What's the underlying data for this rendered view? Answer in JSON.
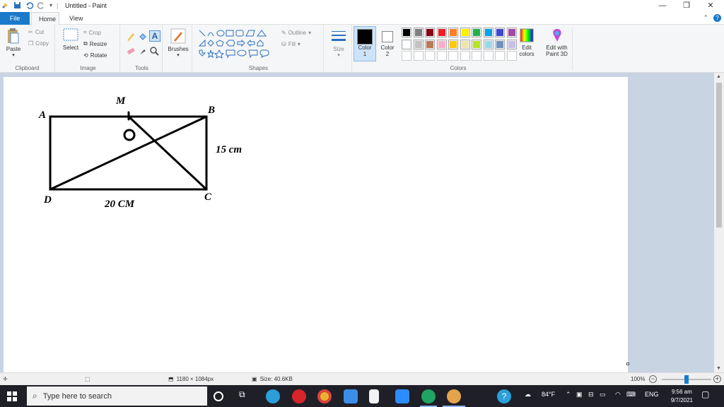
{
  "window": {
    "title": "Untitled - Paint",
    "minimize": "—",
    "maximize": "❐",
    "close": "✕"
  },
  "tabs": {
    "file": "File",
    "home": "Home",
    "view": "View"
  },
  "ribbon": {
    "clipboard": {
      "label": "Clipboard",
      "paste": "Paste",
      "cut": "Cut",
      "copy": "Copy"
    },
    "image": {
      "label": "Image",
      "select": "Select",
      "crop": "Crop",
      "resize": "Resize",
      "rotate": "Rotate"
    },
    "tools": {
      "label": "Tools"
    },
    "brushes": {
      "label": "Brushes"
    },
    "shapes": {
      "label": "Shapes",
      "outline": "Outline",
      "fill": "Fill"
    },
    "size": {
      "label": "Size"
    },
    "color1": {
      "label": "Color",
      "num": "1",
      "color": "#000000"
    },
    "color2": {
      "label": "Color",
      "num": "2",
      "color": "#ffffff"
    },
    "colors": {
      "label": "Colors",
      "row1": [
        "#000000",
        "#7f7f7f",
        "#880015",
        "#ed1c24",
        "#ff7f27",
        "#fff200",
        "#22b14c",
        "#00a2e8",
        "#3f48cc",
        "#a349a4"
      ],
      "row2": [
        "#ffffff",
        "#c3c3c3",
        "#b97a57",
        "#ffaec9",
        "#ffc90e",
        "#efe4b0",
        "#b5e61d",
        "#99d9ea",
        "#7092be",
        "#c8bfe7"
      ]
    },
    "edit_colors": {
      "line1": "Edit",
      "line2": "colors"
    },
    "edit_paint3d": {
      "line1": "Edit with",
      "line2": "Paint 3D"
    }
  },
  "drawing": {
    "label_a": "A",
    "label_b": "B",
    "label_c": "C",
    "label_d": "D",
    "label_m": "M",
    "side_bc": "15 cm",
    "side_dc": "20 CM"
  },
  "status": {
    "dimensions": "1180 × 1084px",
    "size": "Size: 40.6KB",
    "zoom": "100%",
    "zoom_level": 0.5
  },
  "taskbar": {
    "search_placeholder": "Type here to search",
    "weather": "84°F",
    "lang": "ENG",
    "time": "9:56 am",
    "date": "9/7/2021"
  }
}
